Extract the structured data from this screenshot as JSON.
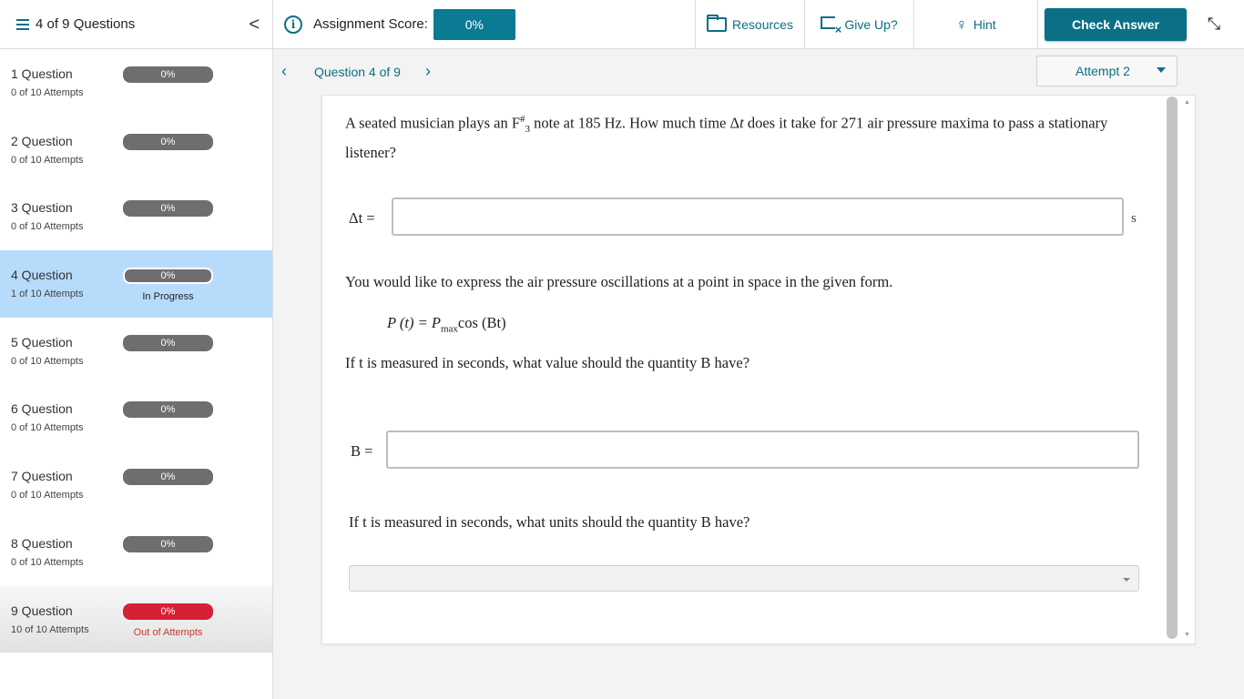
{
  "header": {
    "question_count": "4 of 9 Questions",
    "collapse_glyph": "<",
    "score_label": "Assignment Score:",
    "score_value": "0%",
    "resources": "Resources",
    "give_up": "Give Up?",
    "hint": "Hint",
    "check_answer": "Check Answer",
    "accent_color": "#0b6f86"
  },
  "sidebar": {
    "items": [
      {
        "title": "1 Question",
        "attempts": "0 of 10 Attempts",
        "score": "0%",
        "status": ""
      },
      {
        "title": "2 Question",
        "attempts": "0 of 10 Attempts",
        "score": "0%",
        "status": ""
      },
      {
        "title": "3 Question",
        "attempts": "0 of 10 Attempts",
        "score": "0%",
        "status": ""
      },
      {
        "title": "4 Question",
        "attempts": "1 of 10 Attempts",
        "score": "0%",
        "status": "In Progress"
      },
      {
        "title": "5 Question",
        "attempts": "0 of 10 Attempts",
        "score": "0%",
        "status": ""
      },
      {
        "title": "6 Question",
        "attempts": "0 of 10 Attempts",
        "score": "0%",
        "status": ""
      },
      {
        "title": "7 Question",
        "attempts": "0 of 10 Attempts",
        "score": "0%",
        "status": ""
      },
      {
        "title": "8 Question",
        "attempts": "0 of 10 Attempts",
        "score": "0%",
        "status": ""
      },
      {
        "title": "9 Question",
        "attempts": "10 of 10 Attempts",
        "score": "0%",
        "status": "Out of Attempts"
      }
    ]
  },
  "question_nav": {
    "label": "Question 4 of 9",
    "attempt": "Attempt 2"
  },
  "content": {
    "q1_text_a": "A seated musician plays an F",
    "q1_sup": "#",
    "q1_sub": "3",
    "q1_text_b": " note at 185 Hz. How much time Δ",
    "q1_var": "t",
    "q1_text_c": " does it take for 271 air pressure maxima to pass a stationary listener?",
    "dt_label": "Δt =",
    "dt_value": "",
    "dt_unit": "s",
    "q2_text": "You would like to express the air pressure oscillations at a point in space in the given form.",
    "formula_a": "P (t) = P",
    "formula_sub": "max",
    "formula_b": "cos (Bt)",
    "q3_text": "If t is measured in seconds, what value should the quantity B have?",
    "b_label": "B =",
    "b_value": "",
    "q4_text": "If t is measured in seconds, what units should the quantity B have?",
    "units_selected": ""
  }
}
